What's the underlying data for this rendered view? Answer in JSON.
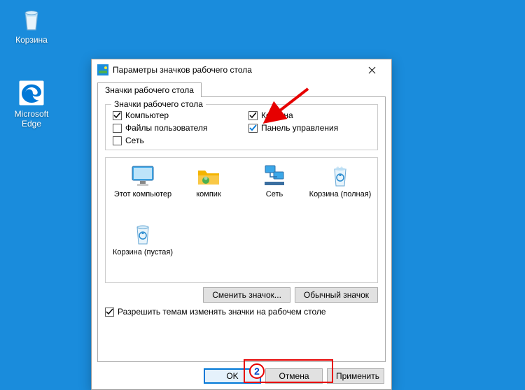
{
  "desktop": {
    "recycle_label": "Корзина",
    "edge_label": "Microsoft Edge"
  },
  "dialog": {
    "title": "Параметры значков рабочего стола",
    "tab_label": "Значки рабочего стола",
    "fieldset_legend": "Значки рабочего стола",
    "checks": {
      "computer": {
        "label": "Компьютер",
        "checked": true
      },
      "user_files": {
        "label": "Файлы пользователя",
        "checked": false
      },
      "network": {
        "label": "Сеть",
        "checked": false
      },
      "recycle": {
        "label": "Корзина",
        "checked": true
      },
      "cpanel": {
        "label": "Панель управления",
        "checked": true
      }
    },
    "preview": {
      "this_pc": "Этот компьютер",
      "kompik": "компик",
      "network": "Сеть",
      "recycle_full": "Корзина (полная)",
      "recycle_empty": "Корзина (пустая)"
    },
    "change_icon_btn": "Сменить значок...",
    "default_icon_btn": "Обычный значок",
    "allow_themes": {
      "label": "Разрешить темам изменять значки на рабочем столе",
      "checked": true
    },
    "footer": {
      "ok": "OK",
      "cancel": "Отмена",
      "apply": "Применить"
    }
  },
  "annotations": {
    "step": "2"
  }
}
